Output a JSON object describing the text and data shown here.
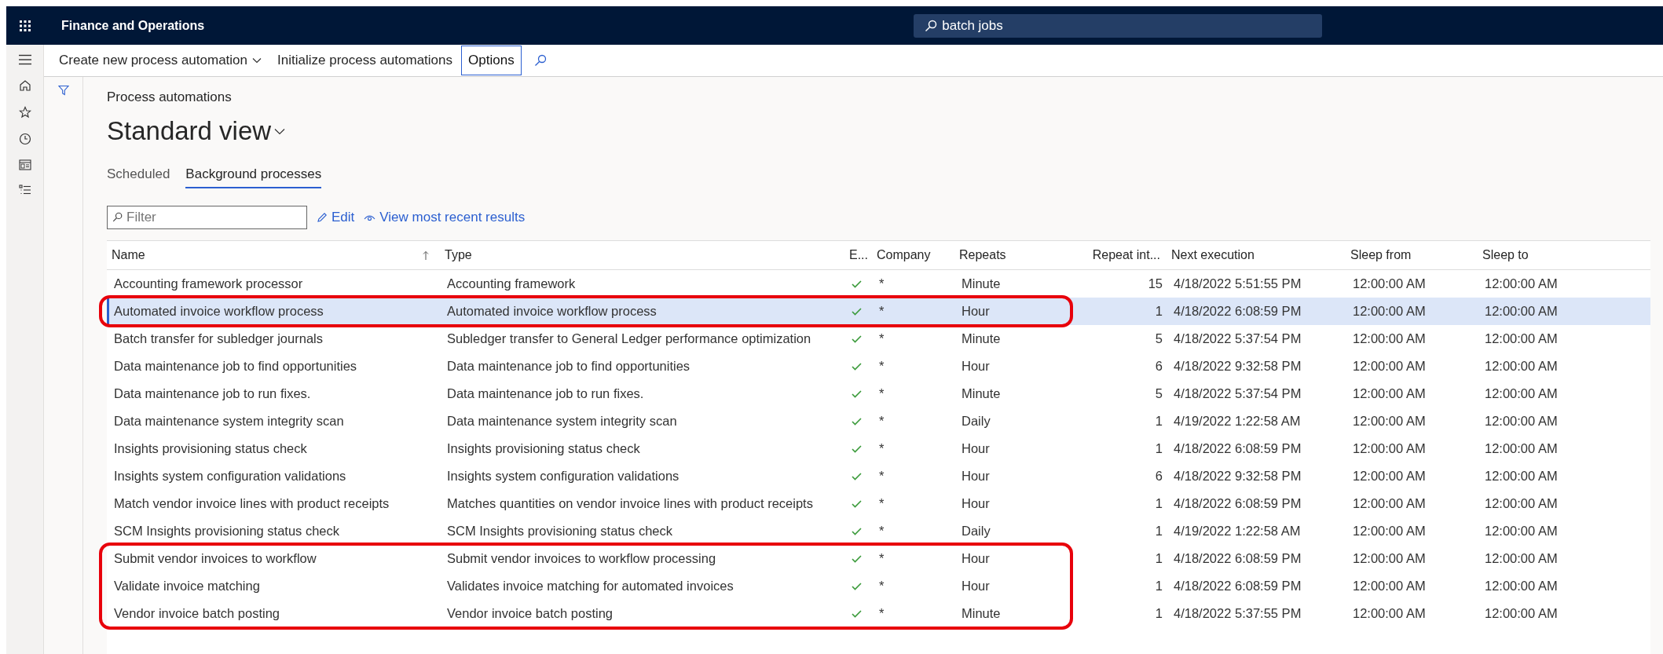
{
  "app_title": "Finance and Operations",
  "search": {
    "value": "batch jobs"
  },
  "action_bar": [
    {
      "label": "Create new process automation",
      "kind": "menu"
    },
    {
      "label": "Initialize process automations",
      "kind": "plain"
    },
    {
      "label": "Options",
      "kind": "boxed"
    }
  ],
  "breadcrumb": "Process automations",
  "view_title": "Standard view",
  "tabs": [
    {
      "label": "Scheduled",
      "selected": false
    },
    {
      "label": "Background processes",
      "selected": true
    }
  ],
  "filter": {
    "placeholder": "Filter"
  },
  "toolbar": [
    {
      "label": "Edit",
      "kind": "edit"
    },
    {
      "label": "View most recent results",
      "kind": "view"
    }
  ],
  "table": {
    "columns": [
      "Name",
      "Type",
      "E...",
      "Company",
      "Repeats",
      "Repeat int...",
      "Next execution",
      "Sleep from",
      "Sleep to"
    ],
    "rows": [
      {
        "name": "Accounting framework processor",
        "type": "Accounting framework",
        "enabled": true,
        "company": "*",
        "repeats": "Minute",
        "interval": "15",
        "next": "4/18/2022 5:51:55 PM",
        "sleep_from": "12:00:00 AM",
        "sleep_to": "12:00:00 AM",
        "selected": false,
        "outlined": false
      },
      {
        "name": "Automated invoice workflow process",
        "type": "Automated invoice workflow process",
        "enabled": true,
        "company": "*",
        "repeats": "Hour",
        "interval": "1",
        "next": "4/18/2022 6:08:59 PM",
        "sleep_from": "12:00:00 AM",
        "sleep_to": "12:00:00 AM",
        "selected": true,
        "outlined": true
      },
      {
        "name": "Batch transfer for subledger journals",
        "type": "Subledger transfer to General Ledger performance optimization",
        "enabled": true,
        "company": "*",
        "repeats": "Minute",
        "interval": "5",
        "next": "4/18/2022 5:37:54 PM",
        "sleep_from": "12:00:00 AM",
        "sleep_to": "12:00:00 AM",
        "selected": false,
        "outlined": false
      },
      {
        "name": "Data maintenance job to find opportunities",
        "type": "Data maintenance job to find opportunities",
        "enabled": true,
        "company": "*",
        "repeats": "Hour",
        "interval": "6",
        "next": "4/18/2022 9:32:58 PM",
        "sleep_from": "12:00:00 AM",
        "sleep_to": "12:00:00 AM",
        "selected": false,
        "outlined": false
      },
      {
        "name": "Data maintenance job to run fixes.",
        "type": "Data maintenance job to run fixes.",
        "enabled": true,
        "company": "*",
        "repeats": "Minute",
        "interval": "5",
        "next": "4/18/2022 5:37:54 PM",
        "sleep_from": "12:00:00 AM",
        "sleep_to": "12:00:00 AM",
        "selected": false,
        "outlined": false
      },
      {
        "name": "Data maintenance system integrity scan",
        "type": "Data maintenance system integrity scan",
        "enabled": true,
        "company": "*",
        "repeats": "Daily",
        "interval": "1",
        "next": "4/19/2022 1:22:58 AM",
        "sleep_from": "12:00:00 AM",
        "sleep_to": "12:00:00 AM",
        "selected": false,
        "outlined": false
      },
      {
        "name": "Insights provisioning status check",
        "type": "Insights provisioning status check",
        "enabled": true,
        "company": "*",
        "repeats": "Hour",
        "interval": "1",
        "next": "4/18/2022 6:08:59 PM",
        "sleep_from": "12:00:00 AM",
        "sleep_to": "12:00:00 AM",
        "selected": false,
        "outlined": false
      },
      {
        "name": "Insights system configuration validations",
        "type": "Insights system configuration validations",
        "enabled": true,
        "company": "*",
        "repeats": "Hour",
        "interval": "6",
        "next": "4/18/2022 9:32:58 PM",
        "sleep_from": "12:00:00 AM",
        "sleep_to": "12:00:00 AM",
        "selected": false,
        "outlined": false
      },
      {
        "name": "Match vendor invoice lines with product receipts",
        "type": "Matches quantities on vendor invoice lines with product receipts",
        "enabled": true,
        "company": "*",
        "repeats": "Hour",
        "interval": "1",
        "next": "4/18/2022 6:08:59 PM",
        "sleep_from": "12:00:00 AM",
        "sleep_to": "12:00:00 AM",
        "selected": false,
        "outlined": false
      },
      {
        "name": "SCM Insights provisioning status check",
        "type": "SCM Insights provisioning status check",
        "enabled": true,
        "company": "*",
        "repeats": "Daily",
        "interval": "1",
        "next": "4/19/2022 1:22:58 AM",
        "sleep_from": "12:00:00 AM",
        "sleep_to": "12:00:00 AM",
        "selected": false,
        "outlined": false
      },
      {
        "name": "Submit vendor invoices to workflow",
        "type": "Submit vendor invoices to workflow processing",
        "enabled": true,
        "company": "*",
        "repeats": "Hour",
        "interval": "1",
        "next": "4/18/2022 6:08:59 PM",
        "sleep_from": "12:00:00 AM",
        "sleep_to": "12:00:00 AM",
        "selected": false,
        "outlined": true
      },
      {
        "name": "Validate invoice matching",
        "type": "Validates invoice matching for automated invoices",
        "enabled": true,
        "company": "*",
        "repeats": "Hour",
        "interval": "1",
        "next": "4/18/2022 6:08:59 PM",
        "sleep_from": "12:00:00 AM",
        "sleep_to": "12:00:00 AM",
        "selected": false,
        "outlined": true
      },
      {
        "name": "Vendor invoice batch posting",
        "type": "Vendor invoice batch posting",
        "enabled": true,
        "company": "*",
        "repeats": "Minute",
        "interval": "1",
        "next": "4/18/2022 5:37:55 PM",
        "sleep_from": "12:00:00 AM",
        "sleep_to": "12:00:00 AM",
        "selected": false,
        "outlined": true
      }
    ]
  }
}
